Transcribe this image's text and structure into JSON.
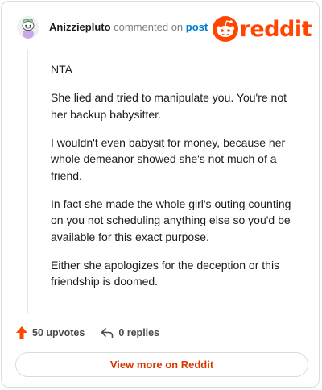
{
  "header": {
    "username": "Anizziepluto",
    "action": "commented on",
    "post_link": "post",
    "brand": "reddit"
  },
  "comment": {
    "paragraphs": [
      "NTA",
      "She lied and tried to manipulate you. You're not her backup babysitter.",
      "I wouldn't even babysit for money, because her whole demeanor showed she's not much of a friend.",
      "In fact she made the whole girl's outing counting on you not scheduling anything else so you'd be available for this exact purpose.",
      "Either she apologizes for the deception or this friendship is doomed."
    ]
  },
  "actions": {
    "upvotes": "50 upvotes",
    "replies": "0 replies"
  },
  "footer": {
    "view_more": "View more on Reddit"
  },
  "colors": {
    "brand": "#ff4500",
    "link": "#0079d3",
    "button_text": "#d93a00"
  },
  "icons": {
    "avatar": "snoo-avatar",
    "logo": "reddit-snoo-icon",
    "upvote": "upvote-arrow-icon",
    "reply": "reply-arrow-icon"
  }
}
